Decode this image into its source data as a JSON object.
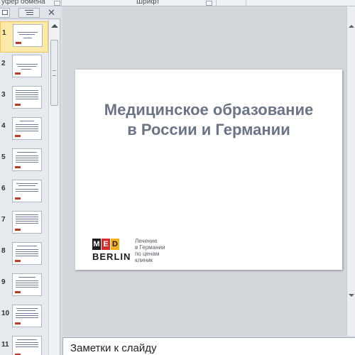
{
  "ribbon": {
    "left_group": "уфер обмена",
    "center_group": "Шрифт"
  },
  "slides_panel": {
    "thumbnails": [
      {
        "number": "1",
        "selected": true
      },
      {
        "number": "2",
        "selected": false
      },
      {
        "number": "3",
        "selected": false
      },
      {
        "number": "4",
        "selected": false
      },
      {
        "number": "5",
        "selected": false
      },
      {
        "number": "6",
        "selected": false
      },
      {
        "number": "7",
        "selected": false
      },
      {
        "number": "8",
        "selected": false
      },
      {
        "number": "9",
        "selected": false
      },
      {
        "number": "10",
        "selected": false
      },
      {
        "number": "11",
        "selected": false
      }
    ]
  },
  "slide": {
    "title_line1": "Медицинское образование",
    "title_line2": "в России и Германии",
    "title_color": "#6b7487",
    "logo": {
      "letters": [
        "M",
        "E",
        "D"
      ],
      "word": "BERLIN",
      "colors": [
        "#1b1b1b",
        "#d92b2b",
        "#f2b21a"
      ]
    },
    "tagline_lines": [
      "Лечение",
      "в Германии",
      "по ценам",
      "клиник"
    ]
  },
  "notes": {
    "placeholder": "Заметки к слайду"
  },
  "colors": {
    "selected_thumb_bg": "#fde9a8",
    "selected_thumb_border": "#f2c45c"
  }
}
